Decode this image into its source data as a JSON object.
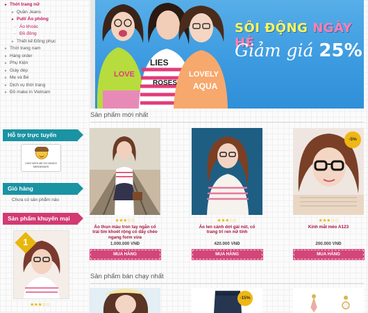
{
  "sidebar": {
    "categories": [
      {
        "label": "Thời trang nữ",
        "level": 0,
        "active": true
      },
      {
        "label": "Quần Jeans",
        "level": 1,
        "active": false
      },
      {
        "label": "Pull/ Áo phông",
        "level": 1,
        "active": true
      },
      {
        "label": "Áo khoác",
        "level": 2,
        "active": false
      },
      {
        "label": "Đồ đông",
        "level": 2,
        "active": false
      },
      {
        "label": "Thiết kế Đồng phục",
        "level": 1,
        "active": false
      },
      {
        "label": "Thời trang nam",
        "level": 0,
        "active": false
      },
      {
        "label": "Hàng order",
        "level": 0,
        "active": false
      },
      {
        "label": "Phụ Kiện",
        "level": 0,
        "active": false
      },
      {
        "label": "Giày dép",
        "level": 0,
        "active": false
      },
      {
        "label": "Mẹ và Bé",
        "level": 0,
        "active": false
      },
      {
        "label": "Dịch vụ thời trang",
        "level": 0,
        "active": false
      },
      {
        "label": "Đồ make in Vietnam",
        "level": 0,
        "active": false
      }
    ],
    "support": {
      "title": "Hỗ trợ trực tuyến",
      "badge_text": "CHAT WITH ME ON YAHOO! MESSENGER"
    },
    "cart": {
      "title": "Giỏ hàng",
      "empty_text": "Chưa có sản phẩm nào"
    },
    "promo": {
      "title": "Sản phẩm khuyến mại",
      "rank": "1",
      "stars": "★★★☆☆"
    }
  },
  "banner": {
    "title_part1": "SÔI ĐỘNG",
    "title_part2": "NGÀY HÈ",
    "subtitle": "Giảm giá",
    "discount": "25%"
  },
  "sections": {
    "new_products": "Sản phẩm mới nhất",
    "best_sellers": "Sản phẩm bán chạy nhất"
  },
  "products": [
    {
      "name": "Áo thun màu tron tay ngắn cổ trái tim khoét rộng có dây chéo ngang form vừa",
      "price": "1.000.000 VNĐ",
      "stars": "★★★☆☆",
      "buy": "MUA HÀNG"
    },
    {
      "name": "Áo len cánh dơi gài nút, cổ trang trí ren nữ tính",
      "price": "420.000 VNĐ",
      "stars": "★★★☆☆",
      "buy": "MUA HÀNG"
    },
    {
      "name": "Kính mắt mèo A123",
      "price": "200.000 VNĐ",
      "stars": "★★★☆☆",
      "buy": "MUA HÀNG",
      "badge": "-5%"
    }
  ],
  "bestseller_badge": "-15%",
  "colors": {
    "brand_pink": "#d34679",
    "teal": "#1a93a3",
    "banner_blue": "#3d9be0"
  }
}
